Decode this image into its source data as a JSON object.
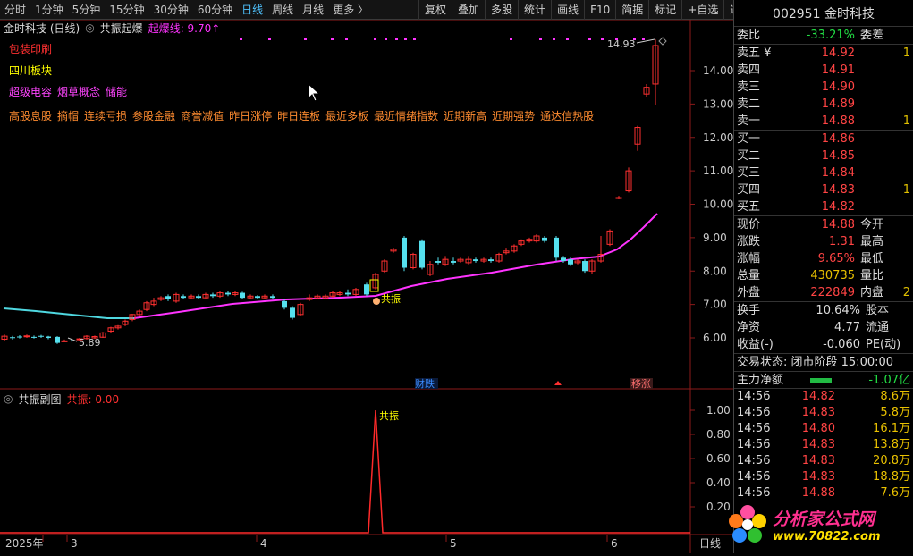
{
  "toolbar": {
    "periods": [
      "分时",
      "1分钟",
      "5分钟",
      "15分钟",
      "30分钟",
      "60分钟",
      "日线",
      "周线",
      "月线",
      "更多 〉"
    ],
    "active_period": "日线",
    "buttons": [
      "复权",
      "叠加",
      "多股",
      "统计",
      "画线",
      "F10",
      "简据",
      "标记",
      "+自选",
      "返回"
    ]
  },
  "main_header": {
    "title": "金时科技 (日线)",
    "indicator_name": "共振起爆",
    "indicator_value": "起爆线: 9.70↑"
  },
  "tags": {
    "line1": "包装印刷",
    "line2": "四川板块",
    "line3": [
      "超级电容",
      "烟草概念",
      "储能"
    ],
    "line4": [
      "高股息股",
      "摘帽",
      "连续亏损",
      "参股金融",
      "商誉减值",
      "昨日涨停",
      "昨日连板",
      "最近多板",
      "最近情绪指数",
      "近期新高",
      "近期强势",
      "通达信热股"
    ]
  },
  "annotations": {
    "high_label": "14.93",
    "low_label": "5.89",
    "gongzhen_label": "共振",
    "event_cai": "财跌",
    "event_zhang": "移涨"
  },
  "sub_header": {
    "title": "共振副图",
    "value": "共振: 0.00",
    "peak_label": "共振"
  },
  "y_axis_main": [
    "14.00",
    "13.00",
    "12.00",
    "11.00",
    "10.00",
    "9.00",
    "8.00",
    "7.00",
    "6.00"
  ],
  "y_axis_sub": [
    "1.00",
    "0.80",
    "0.60",
    "0.40",
    "0.20"
  ],
  "x_axis": {
    "year": "2025年",
    "months": [
      "3",
      "4",
      "5",
      "6"
    ],
    "period_label": "日线"
  },
  "quote": {
    "code_name": "002951 金时科技",
    "weibi_label": "委比",
    "weibi": "-33.21%",
    "weicha_label": "委差",
    "asks": [
      {
        "label": "卖五 ¥",
        "price": "14.92",
        "vol": "1"
      },
      {
        "label": "卖四",
        "price": "14.91",
        "vol": ""
      },
      {
        "label": "卖三",
        "price": "14.90",
        "vol": ""
      },
      {
        "label": "卖二",
        "price": "14.89",
        "vol": ""
      },
      {
        "label": "卖一",
        "price": "14.88",
        "vol": "1"
      }
    ],
    "bids": [
      {
        "label": "买一",
        "price": "14.86",
        "vol": ""
      },
      {
        "label": "买二",
        "price": "14.85",
        "vol": ""
      },
      {
        "label": "买三",
        "price": "14.84",
        "vol": ""
      },
      {
        "label": "买四",
        "price": "14.83",
        "vol": "1"
      },
      {
        "label": "买五",
        "price": "14.82",
        "vol": ""
      }
    ],
    "stats": [
      {
        "l1": "现价",
        "v1": "14.88",
        "c1": "red",
        "l2": "今开",
        "v2": "",
        "c2": "red"
      },
      {
        "l1": "涨跌",
        "v1": "1.31",
        "c1": "red",
        "l2": "最高",
        "v2": "",
        "c2": "red"
      },
      {
        "l1": "涨幅",
        "v1": "9.65%",
        "c1": "red",
        "l2": "最低",
        "v2": "",
        "c2": "red"
      },
      {
        "l1": "总量",
        "v1": "430735",
        "c1": "yellow",
        "l2": "量比",
        "v2": "",
        "c2": "white"
      },
      {
        "l1": "外盘",
        "v1": "222849",
        "c1": "red",
        "l2": "内盘",
        "v2": "2",
        "c2": "green"
      }
    ],
    "stats2": [
      {
        "l1": "换手",
        "v1": "10.64%",
        "l2": "股本"
      },
      {
        "l1": "净资",
        "v1": "4.77",
        "l2": "流通"
      },
      {
        "l1": "收益(-)",
        "v1": "-0.060",
        "l2": "PE(动)"
      }
    ],
    "trade_status": "交易状态: 闭市阶段 15:00:00",
    "main_flow_label": "主力净额",
    "main_flow_value": "-1.07亿",
    "ticks": [
      {
        "t": "14:56",
        "p": "14.82",
        "v": "8.6万"
      },
      {
        "t": "14:56",
        "p": "14.83",
        "v": "5.8万"
      },
      {
        "t": "14:56",
        "p": "14.80",
        "v": "16.1万"
      },
      {
        "t": "14:56",
        "p": "14.83",
        "v": "13.8万"
      },
      {
        "t": "14:56",
        "p": "14.83",
        "v": "20.8万"
      },
      {
        "t": "14:56",
        "p": "14.83",
        "v": "18.8万"
      },
      {
        "t": "14:56",
        "p": "14.88",
        "v": "7.6万"
      }
    ]
  },
  "watermark": {
    "title": "分析家公式网",
    "url": "www.70822.com"
  }
}
